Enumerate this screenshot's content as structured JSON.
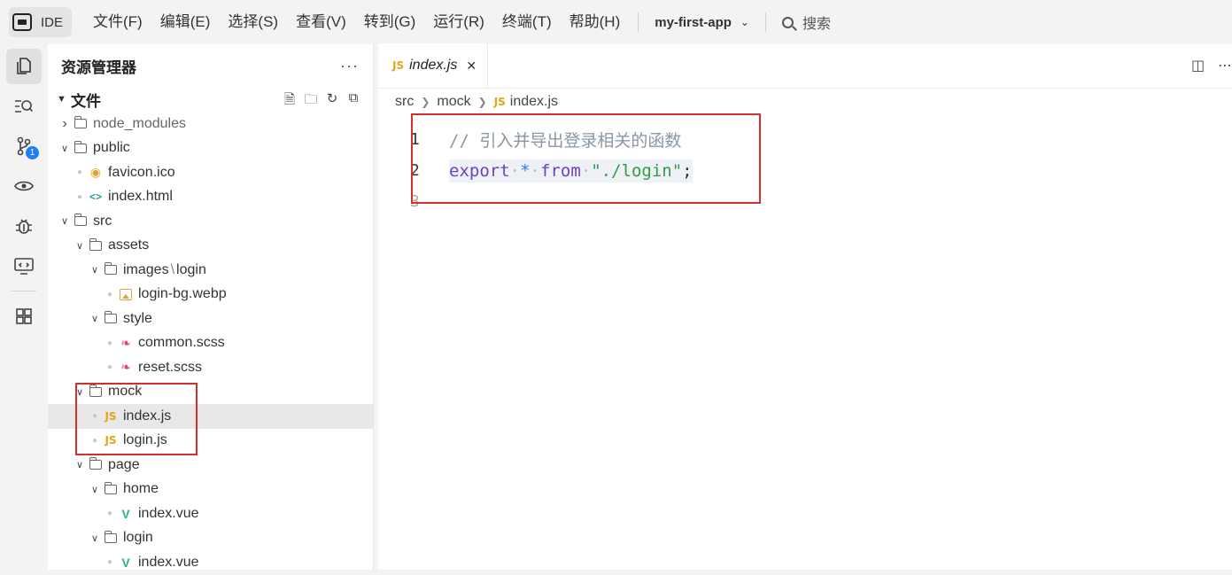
{
  "topbar": {
    "logo_label": "IDE",
    "menu": [
      "文件(F)",
      "编辑(E)",
      "选择(S)",
      "查看(V)",
      "转到(G)",
      "运行(R)",
      "终端(T)",
      "帮助(H)"
    ],
    "project": "my-first-app",
    "search": "搜索"
  },
  "activity": {
    "items": [
      "explorer-icon",
      "search-icon",
      "source-control-icon",
      "preview-icon",
      "debug-icon",
      "remote-icon",
      "extensions-icon"
    ],
    "scm_badge": "1"
  },
  "sidebar": {
    "title": "资源管理器",
    "more": "···",
    "section": "文件",
    "tree": [
      {
        "name": "node_modules",
        "kind": "folder",
        "depth": 0,
        "open": false
      },
      {
        "name": "public",
        "kind": "folder",
        "depth": 0,
        "open": true
      },
      {
        "name": "favicon.ico",
        "kind": "ico",
        "depth": 1
      },
      {
        "name": "index.html",
        "kind": "html",
        "depth": 1
      },
      {
        "name": "src",
        "kind": "folder",
        "depth": 0,
        "open": true
      },
      {
        "name": "assets",
        "kind": "folder",
        "depth": 1,
        "open": true
      },
      {
        "name": "images",
        "name2": "login",
        "kind": "folder",
        "depth": 2,
        "open": true
      },
      {
        "name": "login-bg.webp",
        "kind": "img",
        "depth": 3
      },
      {
        "name": "style",
        "kind": "folder",
        "depth": 2,
        "open": true
      },
      {
        "name": "common.scss",
        "kind": "scss",
        "depth": 3
      },
      {
        "name": "reset.scss",
        "kind": "scss",
        "depth": 3
      },
      {
        "name": "mock",
        "kind": "folder",
        "depth": 1,
        "open": true
      },
      {
        "name": "index.js",
        "kind": "js",
        "depth": 2,
        "selected": true
      },
      {
        "name": "login.js",
        "kind": "js",
        "depth": 2
      },
      {
        "name": "page",
        "kind": "folder",
        "depth": 1,
        "open": true
      },
      {
        "name": "home",
        "kind": "folder",
        "depth": 2,
        "open": true
      },
      {
        "name": "index.vue",
        "kind": "vue",
        "depth": 3
      },
      {
        "name": "login",
        "kind": "folder",
        "depth": 2,
        "open": true
      },
      {
        "name": "index.vue",
        "kind": "vue",
        "depth": 3
      }
    ]
  },
  "editor": {
    "tab": "index.js",
    "breadcrumb": [
      "src",
      "mock",
      "index.js"
    ],
    "lines": [
      {
        "no": "1",
        "comment": "// 引入并导出登录相关的函数"
      },
      {
        "no": "2",
        "kw": "export",
        "op": "*",
        "kw2": "from",
        "str": "\"./login\"",
        "end": ";"
      },
      {
        "no": "3"
      }
    ]
  },
  "colors": {
    "annotation_red": "#d32f2f",
    "js_icon": "#e8a317",
    "vue_icon": "#2bb673",
    "badge_blue": "#1d7ff5"
  }
}
